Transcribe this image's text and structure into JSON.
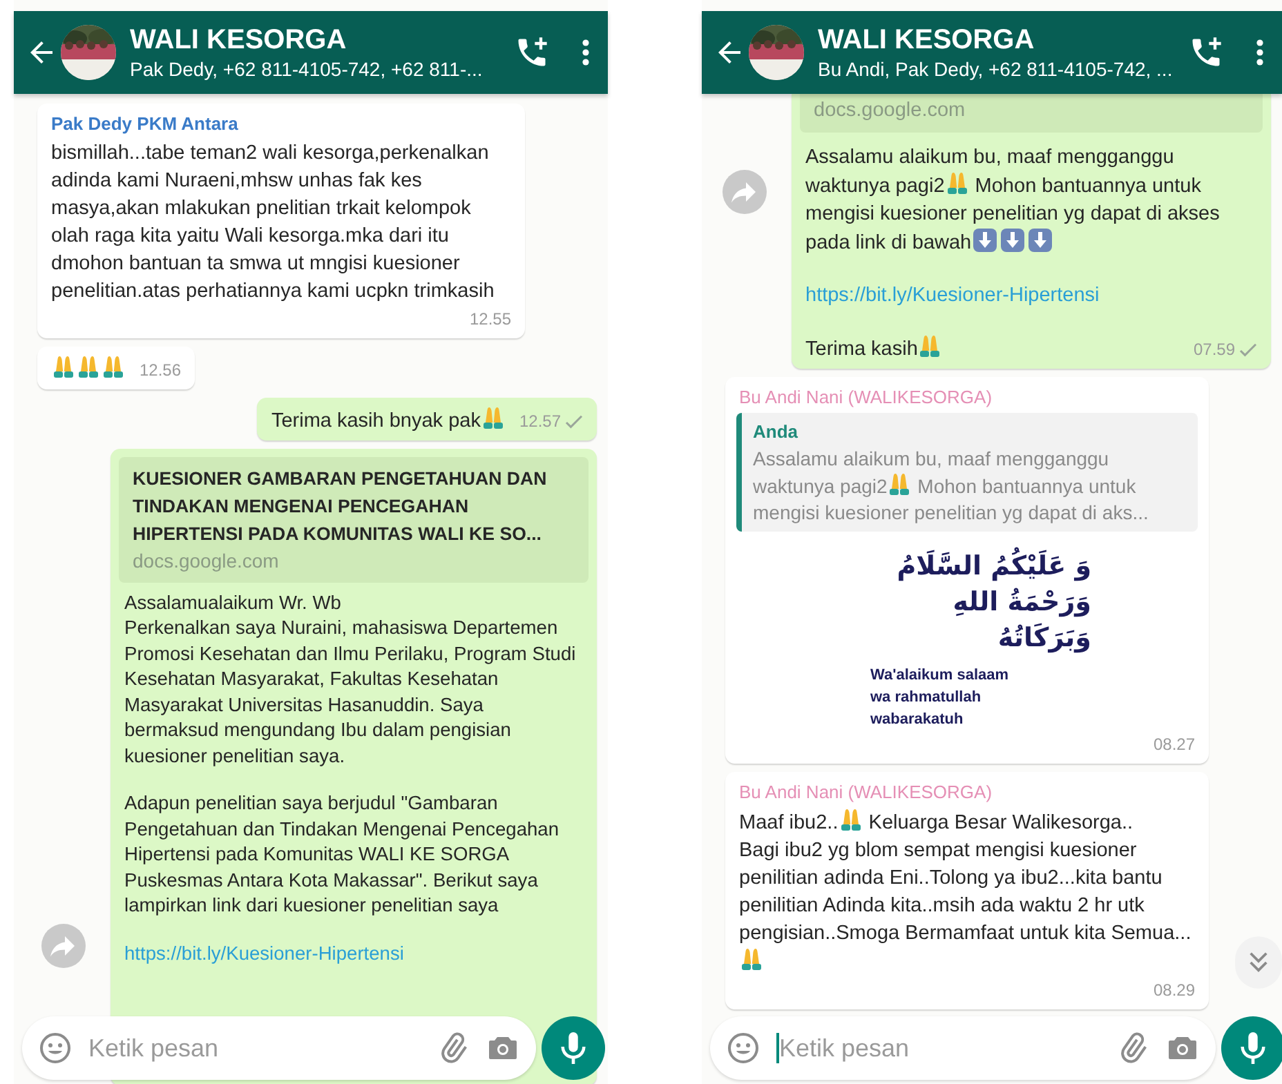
{
  "phones": [
    {
      "header": {
        "title": "WALI KESORGA",
        "subtitle": "Pak Dedy, +62 811-4105-742, +62 811-..."
      },
      "messages": [
        {
          "kind": "incoming",
          "sender": "Pak Dedy PKM Antara",
          "color": "#3a7bc8",
          "paragraphs": [
            [
              {
                "kind": "text",
                "text": "bismillah...tabe teman2 wali kesorga,perkenalkan adinda kami Nuraeni,mhsw unhas fak kes masya,akan mlakukan pnelitian trkait kelompok olah raga kita yaitu Wali kesorga.mka dari itu dmohon bantuan ta smwa ut mngisi kuesioner penelitian.atas perhatiannya kami ucpkn trimkasih"
              }
            ]
          ],
          "time": "12.55",
          "ticked": false
        },
        {
          "kind": "incoming",
          "paragraphs": [
            [
              {
                "kind": "pray"
              },
              {
                "kind": "pray"
              },
              {
                "kind": "pray"
              }
            ]
          ],
          "time": "12.56",
          "ticked": false
        },
        {
          "kind": "outgoing",
          "paragraphs": [
            [
              {
                "kind": "text",
                "text": "Terima kasih bnyak pak"
              },
              {
                "kind": "pray"
              }
            ]
          ],
          "time": "12.57",
          "ticked": true
        },
        {
          "kind": "outgoing",
          "forward": true,
          "preview": {
            "title": "KUESIONER GAMBARAN PENGETAHUAN DAN TINDAKAN MENGENAI PENCEGAHAN HIPERTENSI PADA KOMUNITAS WALI KE SO...",
            "domain": "docs.google.com"
          },
          "paragraphs": [
            [
              {
                "kind": "text",
                "text": "Assalamualaikum Wr. Wb\nPerkenalkan saya Nuraini, mahasiswa Departemen Promosi Kesehatan dan Ilmu Perilaku, Program Studi Kesehatan Masyarakat, Fakultas Kesehatan Masyarakat Universitas Hasanuddin. Saya bermaksud mengundang Ibu dalam pengisian kuesioner penelitian saya."
              }
            ],
            [
              {
                "kind": "text",
                "text": "Adapun penelitian saya berjudul \"Gambaran Pengetahuan dan Tindakan Mengenai Pencegahan Hipertensi pada Komunitas WALI KE SORGA Puskesmas Antara Kota Makassar\". Berikut saya lampirkan link dari kuesioner penelitian saya"
              }
            ],
            [
              {
                "kind": "link",
                "text": "https://bit.ly/Kuesioner-Hipertensi"
              }
            ]
          ]
        }
      ],
      "composer": {
        "placeholder": "Ketik pesan"
      }
    },
    {
      "header": {
        "title": "WALI KESORGA",
        "subtitle": "Bu Andi, Pak Dedy, +62 811-4105-742, ..."
      },
      "messages": [
        {
          "kind": "outgoing",
          "forward": true,
          "preview": {
            "domain": "docs.google.com"
          },
          "paragraphs": [
            [
              {
                "kind": "text",
                "text": "Assalamu alaikum bu, maaf mengganggu waktunya pagi2"
              },
              {
                "kind": "pray"
              },
              {
                "kind": "text",
                "text": " Mohon bantuannya untuk mengisi kuesioner penelitian yg dapat di akses pada link di bawah"
              },
              {
                "kind": "down"
              },
              {
                "kind": "down"
              },
              {
                "kind": "down"
              }
            ],
            [
              {
                "kind": "link",
                "text": "https://bit.ly/Kuesioner-Hipertensi"
              }
            ],
            [
              {
                "kind": "text",
                "text": "Terima kasih"
              },
              {
                "kind": "pray"
              }
            ]
          ],
          "time": "07.59",
          "ticked": true
        },
        {
          "kind": "incoming",
          "sender": "Bu Andi Nani (WALIKESORGA)",
          "color": "#e58fb5",
          "quote": {
            "author": "Anda",
            "parts": [
              {
                "kind": "text",
                "text": "Assalamu alaikum bu, maaf mengganggu waktunya pagi2"
              },
              {
                "kind": "pray"
              },
              {
                "kind": "text",
                "text": " Mohon bantuannya untuk mengisi kuesioner penelitian yg dapat di aks..."
              }
            ]
          },
          "greeting": {
            "arabic": "وَ عَلَيْكُمُ السَّلَامُ\nوَرَحْمَةُ اللهِ\nوَبَرَكَاتُهُ",
            "latin": "Wa'alaikum salaam\nwa rahmatullah\nwabarakatuh"
          },
          "time": "08.27",
          "ticked": false
        },
        {
          "kind": "incoming",
          "sender": "Bu Andi Nani (WALIKESORGA)",
          "color": "#e58fb5",
          "paragraphs": [
            [
              {
                "kind": "text",
                "text": "Maaf ibu2.."
              },
              {
                "kind": "pray"
              },
              {
                "kind": "text",
                "text": " Keluarga Besar Walikesorga..\nBagi ibu2 yg blom sempat mengisi kuesioner penilitian adinda Eni..Tolong ya ibu2...kita bantu penilitian Adinda kita..msih ada waktu 2 hr utk pengisian..Smoga Bermamfaat untuk kita Semua..."
              },
              {
                "kind": "pray"
              }
            ]
          ],
          "time": "08.29",
          "ticked": false
        }
      ],
      "scroll_down": true,
      "composer": {
        "placeholder": "Ketik pesan",
        "focused": true
      }
    }
  ]
}
